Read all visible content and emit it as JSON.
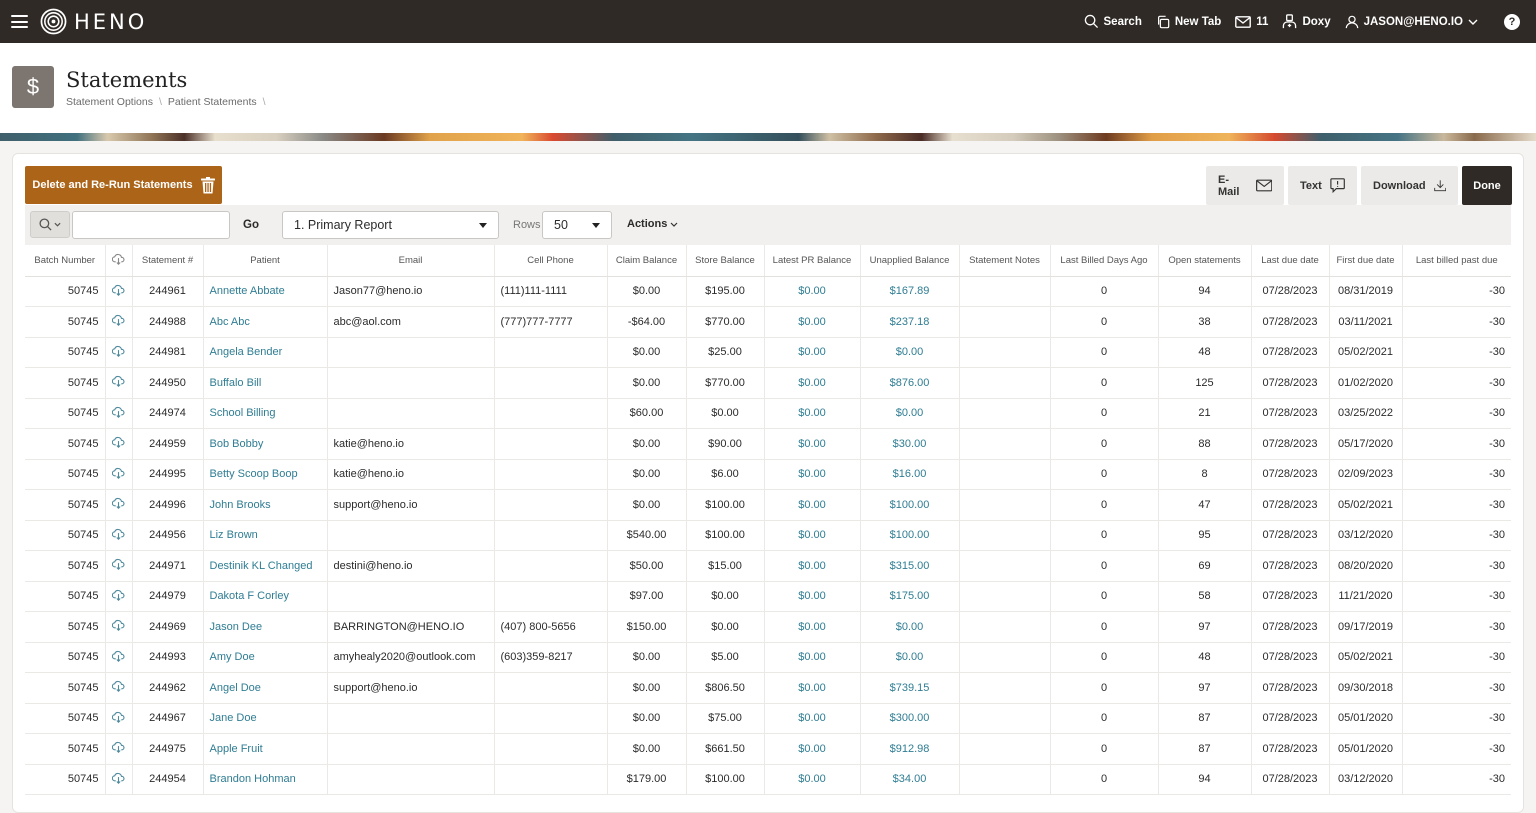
{
  "nav": {
    "brand": "HENO",
    "search_label": "Search",
    "new_tab_label": "New Tab",
    "mail_count": "11",
    "doxy_label": "Doxy",
    "user_label": "JASON@HENO.IO",
    "help_label": "?"
  },
  "header": {
    "icon_glyph": "$",
    "title": "Statements",
    "breadcrumb": [
      "Statement Options",
      "Patient Statements"
    ],
    "separator": "\\"
  },
  "actions": {
    "rerun_label": "Delete and Re-Run Statements",
    "email_label": "E-Mail",
    "text_label": "Text",
    "download_label": "Download",
    "done_label": "Done"
  },
  "toolbar": {
    "search_value": "",
    "search_placeholder": "",
    "go_label": "Go",
    "report_value": "1. Primary Report",
    "rows_label": "Rows",
    "rows_value": "50",
    "actions_label": "Actions"
  },
  "table": {
    "columns": [
      "Batch Number",
      "",
      "Statement #",
      "Patient",
      "Email",
      "Cell Phone",
      "Claim Balance",
      "Store Balance",
      "Latest PR Balance",
      "Unapplied Balance",
      "Statement Notes",
      "Last Billed Days Ago",
      "Open statements",
      "Last due date",
      "First due date",
      "Last billed past due"
    ],
    "rows": [
      [
        "50745",
        "244961",
        "Annette Abbate",
        "Jason77@heno.io",
        "(111)111-1111",
        "$0.00",
        "$195.00",
        "$0.00",
        "$167.89",
        "",
        "0",
        "94",
        "07/28/2023",
        "08/31/2019",
        "-30"
      ],
      [
        "50745",
        "244988",
        "Abc Abc",
        "abc@aol.com",
        "(777)777-7777",
        "-$64.00",
        "$770.00",
        "$0.00",
        "$237.18",
        "",
        "0",
        "38",
        "07/28/2023",
        "03/11/2021",
        "-30"
      ],
      [
        "50745",
        "244981",
        "Angela Bender",
        "",
        "",
        "$0.00",
        "$25.00",
        "$0.00",
        "$0.00",
        "",
        "0",
        "48",
        "07/28/2023",
        "05/02/2021",
        "-30"
      ],
      [
        "50745",
        "244950",
        "Buffalo Bill",
        "",
        "",
        "$0.00",
        "$770.00",
        "$0.00",
        "$876.00",
        "",
        "0",
        "125",
        "07/28/2023",
        "01/02/2020",
        "-30"
      ],
      [
        "50745",
        "244974",
        "School Billing",
        "",
        "",
        "$60.00",
        "$0.00",
        "$0.00",
        "$0.00",
        "",
        "0",
        "21",
        "07/28/2023",
        "03/25/2022",
        "-30"
      ],
      [
        "50745",
        "244959",
        "Bob Bobby",
        "katie@heno.io",
        "",
        "$0.00",
        "$90.00",
        "$0.00",
        "$30.00",
        "",
        "0",
        "88",
        "07/28/2023",
        "05/17/2020",
        "-30"
      ],
      [
        "50745",
        "244995",
        "Betty Scoop Boop",
        "katie@heno.io",
        "",
        "$0.00",
        "$6.00",
        "$0.00",
        "$16.00",
        "",
        "0",
        "8",
        "07/28/2023",
        "02/09/2023",
        "-30"
      ],
      [
        "50745",
        "244996",
        "John Brooks",
        "support@heno.io",
        "",
        "$0.00",
        "$100.00",
        "$0.00",
        "$100.00",
        "",
        "0",
        "47",
        "07/28/2023",
        "05/02/2021",
        "-30"
      ],
      [
        "50745",
        "244956",
        "Liz Brown",
        "",
        "",
        "$540.00",
        "$100.00",
        "$0.00",
        "$100.00",
        "",
        "0",
        "95",
        "07/28/2023",
        "03/12/2020",
        "-30"
      ],
      [
        "50745",
        "244971",
        "Destinik KL Changed",
        "destini@heno.io",
        "",
        "$50.00",
        "$15.00",
        "$0.00",
        "$315.00",
        "",
        "0",
        "69",
        "07/28/2023",
        "08/20/2020",
        "-30"
      ],
      [
        "50745",
        "244979",
        "Dakota F Corley",
        "",
        "",
        "$97.00",
        "$0.00",
        "$0.00",
        "$175.00",
        "",
        "0",
        "58",
        "07/28/2023",
        "11/21/2020",
        "-30"
      ],
      [
        "50745",
        "244969",
        "Jason Dee",
        "BARRINGTON@HENO.IO",
        "(407) 800-5656",
        "$150.00",
        "$0.00",
        "$0.00",
        "$0.00",
        "",
        "0",
        "97",
        "07/28/2023",
        "09/17/2019",
        "-30"
      ],
      [
        "50745",
        "244993",
        "Amy Doe",
        "amyhealy2020@outlook.com",
        "(603)359-8217",
        "$0.00",
        "$5.00",
        "$0.00",
        "$0.00",
        "",
        "0",
        "48",
        "07/28/2023",
        "05/02/2021",
        "-30"
      ],
      [
        "50745",
        "244962",
        "Angel Doe",
        "support@heno.io",
        "",
        "$0.00",
        "$806.50",
        "$0.00",
        "$739.15",
        "",
        "0",
        "97",
        "07/28/2023",
        "09/30/2018",
        "-30"
      ],
      [
        "50745",
        "244967",
        "Jane Doe",
        "",
        "",
        "$0.00",
        "$75.00",
        "$0.00",
        "$300.00",
        "",
        "0",
        "87",
        "07/28/2023",
        "05/01/2020",
        "-30"
      ],
      [
        "50745",
        "244975",
        "Apple Fruit",
        "",
        "",
        "$0.00",
        "$661.50",
        "$0.00",
        "$912.98",
        "",
        "0",
        "87",
        "07/28/2023",
        "05/01/2020",
        "-30"
      ],
      [
        "50745",
        "244954",
        "Brandon Hohman",
        "",
        "",
        "$179.00",
        "$100.00",
        "$0.00",
        "$34.00",
        "",
        "0",
        "94",
        "07/28/2023",
        "03/12/2020",
        "-30"
      ]
    ]
  },
  "colors": {
    "topbar": "#2f2a26",
    "accent_button": "#ab6418",
    "link": "#2f7d93"
  }
}
